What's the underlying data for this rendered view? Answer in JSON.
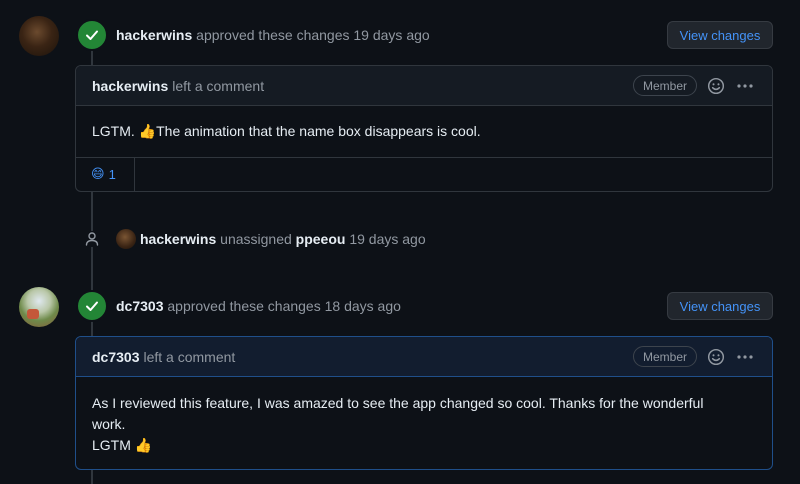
{
  "events": [
    {
      "user": "hackerwins",
      "action": "approved these changes",
      "time": "19 days ago",
      "button": "View changes",
      "comment": {
        "user": "hackerwins",
        "action": "left a comment",
        "badge": "Member",
        "body": "LGTM. 👍The animation that the name box disappears is cool.",
        "reaction": {
          "emoji": "😄",
          "count": "1"
        }
      }
    },
    {
      "user": "dc7303",
      "action": "approved these changes",
      "time": "18 days ago",
      "button": "View changes",
      "comment": {
        "user": "dc7303",
        "action": "left a comment",
        "badge": "Member",
        "body_line1": "As I reviewed this feature, I was amazed to see the app changed so cool. Thanks for the wonderful",
        "body_line2": "work.",
        "body_line3": "LGTM 👍"
      }
    }
  ],
  "unassign": {
    "actor": "hackerwins",
    "action": "unassigned",
    "target": "ppeeou",
    "time": "19 days ago"
  },
  "colors": {
    "background": "#0d1117",
    "success": "#238636",
    "link": "#4493f8",
    "border": "#30363d"
  }
}
